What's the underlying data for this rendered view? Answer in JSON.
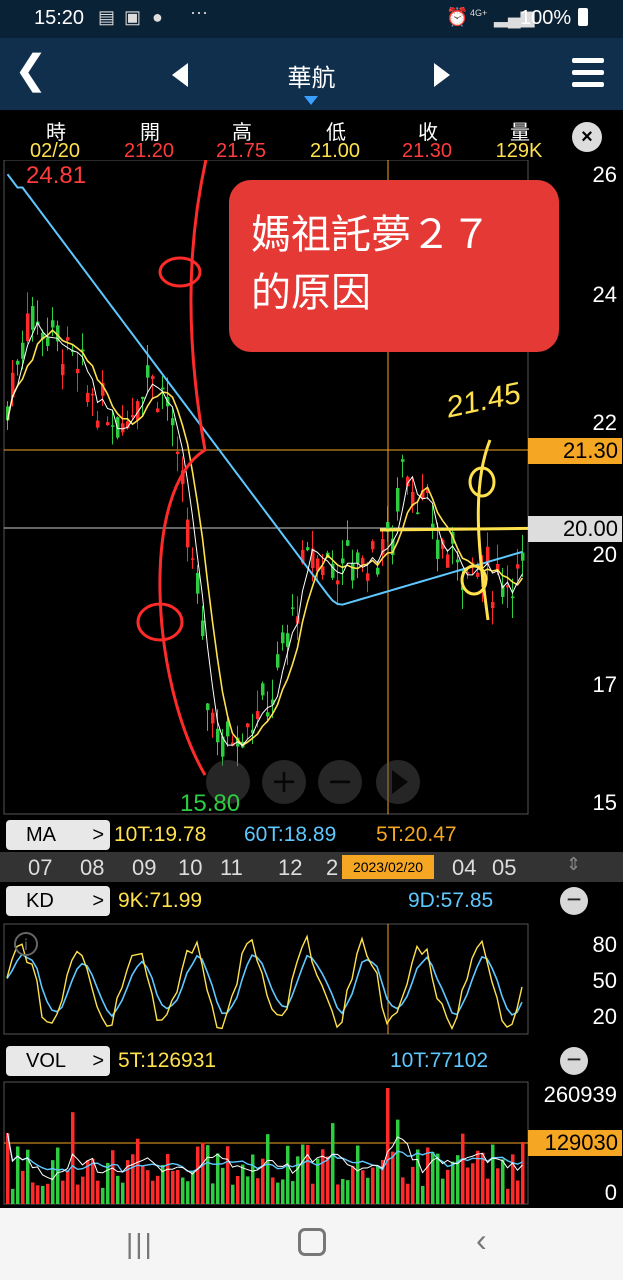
{
  "status_bar": {
    "time": "15:20",
    "network": "4G+",
    "battery": "100%"
  },
  "nav": {
    "title": "華航"
  },
  "quote": {
    "headers": [
      "時",
      "開",
      "高",
      "低",
      "收",
      "量"
    ],
    "values": [
      "02/20",
      "21.20",
      "21.75",
      "21.00",
      "21.30",
      "129K"
    ]
  },
  "price_chart": {
    "high_label": "24.81",
    "low_label": "15.80",
    "y_ticks": [
      "26",
      "24",
      "22",
      "20",
      "17",
      "15"
    ],
    "current_tag": "21.30",
    "cursor_tag": "20.00"
  },
  "annotation": {
    "line1": "媽祖託夢２７",
    "line2": "的原因",
    "handwriting": "21.45"
  },
  "ma_row": {
    "button": "MA",
    "ma10": "10T:19.78",
    "ma60": "60T:18.89",
    "ma5": "5T:20.47"
  },
  "time_axis": {
    "labels": [
      "07",
      "08",
      "09",
      "10",
      "11",
      "12",
      "2"
    ],
    "selected_date": "2023/02/20",
    "labels_right": [
      "04",
      "05"
    ]
  },
  "kd_row": {
    "button": "KD",
    "k": "9K:71.99",
    "d": "9D:57.85",
    "ticks": [
      "80",
      "50",
      "20"
    ]
  },
  "vol_row": {
    "button": "VOL",
    "v5": "5T:126931",
    "v10": "10T:77102",
    "max": "260939",
    "current_tag": "129030",
    "zero": "0"
  },
  "colors": {
    "up": "#ff2b2b",
    "down": "#2ecc40",
    "ma5": "#ffffff",
    "ma10": "#ffe14d",
    "ma60": "#5ec8ff",
    "accent": "#f5a623"
  }
}
